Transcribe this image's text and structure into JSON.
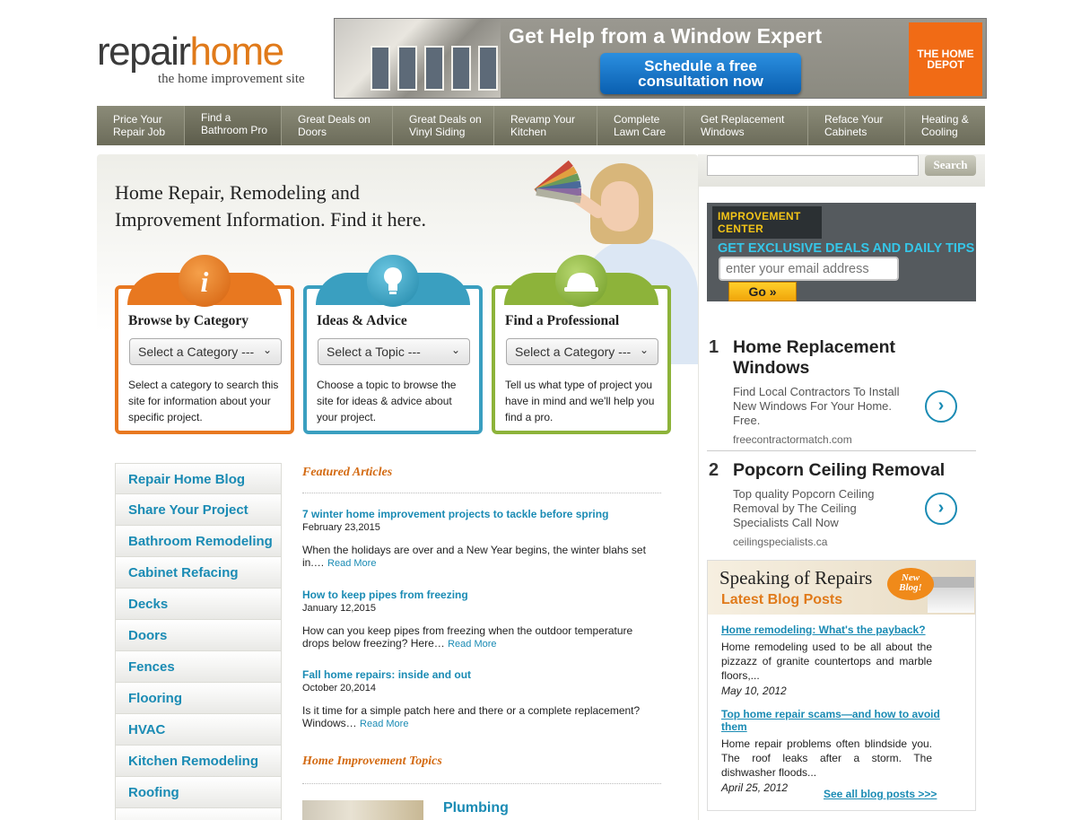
{
  "logo": {
    "part1": "repair",
    "part2": "home",
    "tagline": "the home improvement site"
  },
  "banner": {
    "headline": "Get Help from a Window Expert",
    "button_line1": "Schedule a free",
    "button_line2": "consultation now",
    "brand": "THE HOME DEPOT"
  },
  "nav": [
    {
      "line1": "Price Your",
      "line2": "Repair Job"
    },
    {
      "line1": "Find a",
      "line2": "Bathroom Pro"
    },
    {
      "line1": "Great Deals on",
      "line2": "Doors"
    },
    {
      "line1": "Great Deals on",
      "line2": "Vinyl Siding"
    },
    {
      "line1": "Revamp Your",
      "line2": "Kitchen"
    },
    {
      "line1": "Complete",
      "line2": "Lawn Care"
    },
    {
      "line1": "Get Replacement",
      "line2": "Windows"
    },
    {
      "line1": "Reface Your",
      "line2": "Cabinets"
    },
    {
      "line1": "Heating &",
      "line2": "Cooling"
    }
  ],
  "hero": {
    "title_line1": "Home Repair, Remodeling and",
    "title_line2": "Improvement Information. Find it here."
  },
  "cards": [
    {
      "title": "Browse by Category",
      "select": "Select a Category ---",
      "desc": "Select a category to search this site for information about your specific project.",
      "color": "#e87820",
      "icon": "info-icon"
    },
    {
      "title": "Ideas & Advice",
      "select": "Select a Topic ---",
      "desc": "Choose a topic to browse the site for ideas & advice about your project.",
      "color": "#3a9fc0",
      "icon": "lightbulb-icon"
    },
    {
      "title": "Find a Professional",
      "select": "Select a Category ---",
      "desc": "Tell us what type of project you have in mind and we'll help you find a pro.",
      "color": "#8db33a",
      "icon": "hardhat-icon"
    }
  ],
  "categories": [
    "Repair Home Blog",
    "Share Your Project",
    "Bathroom Remodeling",
    "Cabinet Refacing",
    "Decks",
    "Doors",
    "Fences",
    "Flooring",
    "HVAC",
    "Kitchen Remodeling",
    "Roofing"
  ],
  "featured": {
    "heading": "Featured Articles",
    "articles": [
      {
        "title": "7 winter home improvement projects to tackle before spring",
        "date": "February 23,2015",
        "body": "When the holidays are over and a New Year begins, the winter blahs set in.… ",
        "more": "Read More"
      },
      {
        "title": "How to keep pipes from freezing",
        "date": "January 12,2015",
        "body": "How can you keep pipes from freezing when the outdoor temperature drops below freezing? Here… ",
        "more": "Read More"
      },
      {
        "title": "Fall home repairs: inside and out",
        "date": "October 20,2014",
        "body": "Is it time for a simple patch here and there or a complete replacement? Windows… ",
        "more": "Read More"
      }
    ]
  },
  "topics": {
    "heading": "Home Improvement Topics",
    "first": "Plumbing"
  },
  "search": {
    "placeholder": "",
    "button": "Search"
  },
  "improvement": {
    "logo_line1": "IMPROVEMENT",
    "logo_line2": "CENTER",
    "headline": "GET EXCLUSIVE DEALS AND DAILY TIPS",
    "placeholder": "enter your email address",
    "go": "Go »"
  },
  "ads": [
    {
      "num": "1",
      "title": "Home Replacement Windows",
      "desc": "Find Local Contractors To Install New Windows For Your Home. Free.",
      "domain": "freecontractormatch.com"
    },
    {
      "num": "2",
      "title": "Popcorn Ceiling Removal",
      "desc": "Top quality Popcorn Ceiling Removal by The Ceiling Specialists Call Now",
      "domain": "ceilingspecialists.ca"
    }
  ],
  "blog": {
    "title": "Speaking of Repairs",
    "subtitle": "Latest Blog Posts",
    "badge_line1": "New",
    "badge_line2": "Blog!",
    "posts": [
      {
        "title": "Home remodeling: What's the payback?",
        "text": "Home remodeling used to be all about the pizzazz of granite countertops and marble floors,...",
        "date": "May 10, 2012"
      },
      {
        "title": "Top home repair scams—and how to avoid them",
        "text": "Home repair problems often blindside you. The roof leaks after a storm. The dishwasher floods...",
        "date": "April 25, 2012"
      }
    ],
    "see_all": "See all blog posts >>>"
  }
}
